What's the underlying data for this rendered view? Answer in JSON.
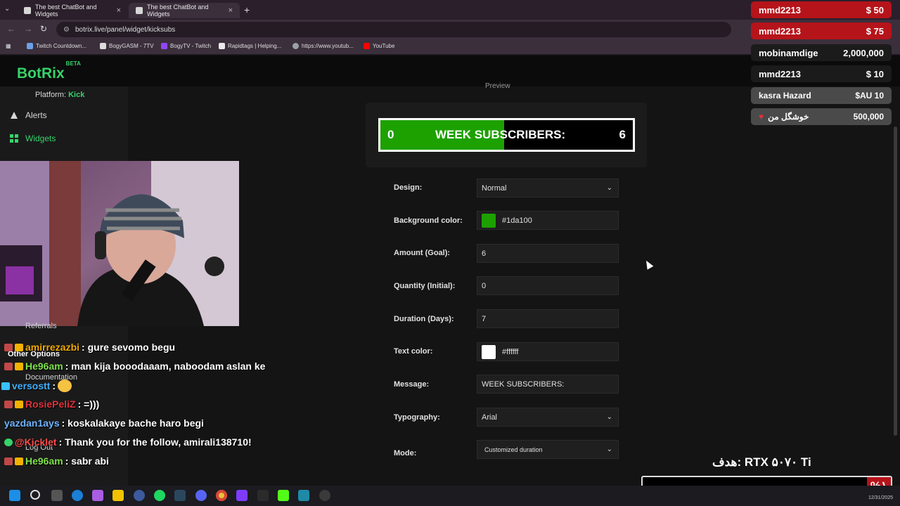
{
  "browser": {
    "tabs": [
      {
        "title": "The best ChatBot and Widgets"
      },
      {
        "title": "The best ChatBot and Widgets"
      }
    ],
    "url": "botrix.live/panel/widget/kicksubs",
    "bookmarks": [
      {
        "label": "Twitch Countdown..."
      },
      {
        "label": "BogyGASM - 7TV"
      },
      {
        "label": "BogyTV - Twitch"
      },
      {
        "label": "Rapidtags | Helping..."
      },
      {
        "label": "https://www.youtub..."
      },
      {
        "label": "YouTube"
      }
    ]
  },
  "app": {
    "logo": "BotRix",
    "logo_badge": "BETA",
    "platform_label": "Platform:",
    "platform_value": "Kick"
  },
  "sidebar": {
    "items": [
      {
        "label": "Alerts",
        "icon": "warning-icon"
      },
      {
        "label": "Widgets",
        "icon": "grid-icon"
      }
    ],
    "other_options": "Other Options",
    "documentation": "Documentation",
    "logout": "Log Out",
    "referrals": "Referrals"
  },
  "preview": {
    "label": "Preview",
    "current": "0",
    "message": "WEEK SUBSCRIBERS:",
    "goal": "6",
    "fill_fraction": 0.49
  },
  "form": {
    "design_label": "Design:",
    "design_value": "Normal",
    "bg_color_label": "Background color:",
    "bg_color_value": "#1da100",
    "amount_label": "Amount (Goal):",
    "amount_value": "6",
    "quantity_label": "Quantity (Initial):",
    "quantity_value": "0",
    "duration_label": "Duration (Days):",
    "duration_value": "7",
    "text_color_label": "Text color:",
    "text_color_value": "#ffffff",
    "message_label": "Message:",
    "message_value": "WEEK SUBSCRIBERS:",
    "typography_label": "Typography:",
    "typography_value": "Arial",
    "mode_label": "Mode:",
    "mode_value": "Customized duration"
  },
  "chat": [
    {
      "user": "amirrezazbi",
      "text": ": gure sevomo begu",
      "color": "#f2a900"
    },
    {
      "user": "He96am",
      "text": ": man kija booodaaam, naboodam aslan ke",
      "color": "#7de04a"
    },
    {
      "user": "versostt",
      "text": ":",
      "color": "#3fb0ff"
    },
    {
      "user": "RosiePeliZ",
      "text": ": =)))",
      "color": "#e0323c"
    },
    {
      "user": "yazdan1ays",
      "text": ": koskalakaye bache haro begi",
      "color": "#6fb3ff"
    },
    {
      "user": "@Kicklet",
      "text": ": Thank you for the follow, amirali138710!",
      "color": "#ff4c4c"
    },
    {
      "user": "He96am",
      "text": ": sabr abi",
      "color": "#7de04a"
    }
  ],
  "donations": [
    {
      "name": "mmd2213",
      "amount": "$ 50"
    },
    {
      "name": "mmd2213",
      "amount": "$ 75"
    },
    {
      "name": "mobinamdige",
      "amount": "2,000,000"
    },
    {
      "name": "mmd2213",
      "amount": "$ 10"
    },
    {
      "name": "kasra Hazard",
      "amount": "$AU 10"
    },
    {
      "name": "خوشگل من",
      "amount": "500,000"
    }
  ],
  "stream_goal": {
    "title": "هدف: RTX ۵۰۷۰ Ti",
    "percent": "%۱"
  },
  "taskbar": {
    "date": "12/31/2025"
  }
}
